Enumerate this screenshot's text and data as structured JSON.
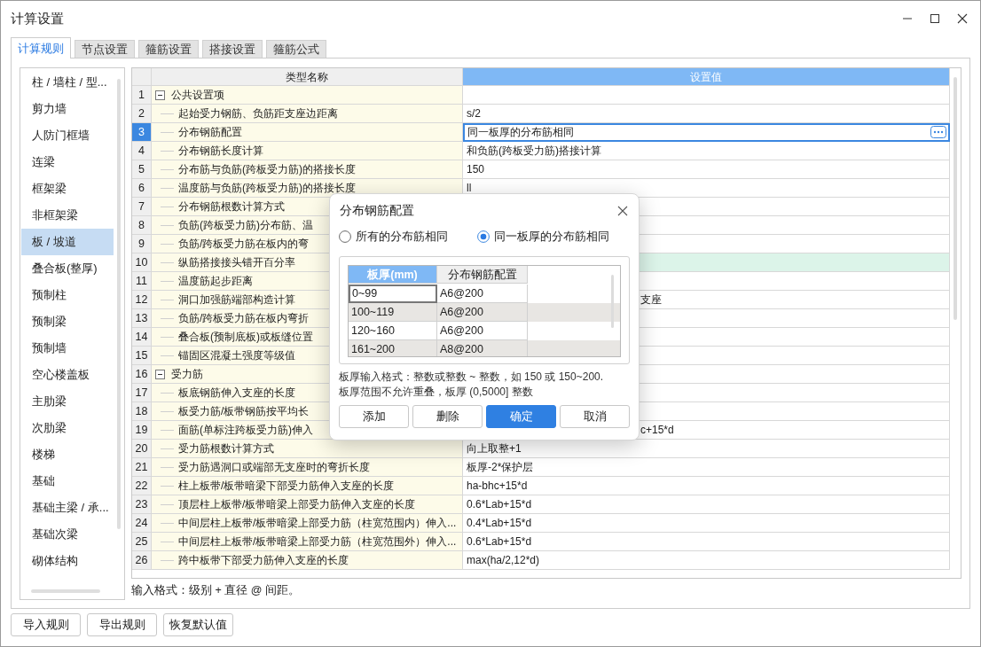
{
  "window": {
    "title": "计算设置"
  },
  "tabs": [
    {
      "label": "计算规则",
      "selected": true
    },
    {
      "label": "节点设置",
      "selected": false
    },
    {
      "label": "箍筋设置",
      "selected": false
    },
    {
      "label": "搭接设置",
      "selected": false
    },
    {
      "label": "箍筋公式",
      "selected": false
    }
  ],
  "sidebar": {
    "items": [
      {
        "label": "柱 / 墙柱 / 型...",
        "selected": false
      },
      {
        "label": "剪力墙",
        "selected": false
      },
      {
        "label": "人防门框墙",
        "selected": false
      },
      {
        "label": "连梁",
        "selected": false
      },
      {
        "label": "框架梁",
        "selected": false
      },
      {
        "label": "非框架梁",
        "selected": false
      },
      {
        "label": "板 / 坡道",
        "selected": true
      },
      {
        "label": "叠合板(整厚)",
        "selected": false
      },
      {
        "label": "预制柱",
        "selected": false
      },
      {
        "label": "预制梁",
        "selected": false
      },
      {
        "label": "预制墙",
        "selected": false
      },
      {
        "label": "空心楼盖板",
        "selected": false
      },
      {
        "label": "主肋梁",
        "selected": false
      },
      {
        "label": "次肋梁",
        "selected": false
      },
      {
        "label": "楼梯",
        "selected": false
      },
      {
        "label": "基础",
        "selected": false
      },
      {
        "label": "基础主梁 / 承...",
        "selected": false
      },
      {
        "label": "基础次梁",
        "selected": false
      },
      {
        "label": "砌体结构",
        "selected": false
      }
    ]
  },
  "table": {
    "columns": [
      {
        "label": "类型名称",
        "selected": false
      },
      {
        "label": "设置值",
        "selected": true
      }
    ],
    "rows": [
      {
        "number": "1",
        "name": "公共设置项",
        "kind": "group",
        "expanded": true,
        "selected": false,
        "children": [
          {
            "number": "2",
            "name": "起始受力钢筋、负筋距支座边距离",
            "value": "s/2",
            "selected": false,
            "highlighted": false
          },
          {
            "number": "3",
            "name": "分布钢筋配置",
            "value": "同一板厚的分布筋相同",
            "selected": true,
            "highlighted": false
          },
          {
            "number": "4",
            "name": "分布钢筋长度计算",
            "value": "和负筋(跨板受力筋)搭接计算",
            "selected": false,
            "highlighted": false
          },
          {
            "number": "5",
            "name": "分布筋与负筋(跨板受力筋)的搭接长度",
            "value": "150",
            "selected": false,
            "highlighted": false
          },
          {
            "number": "6",
            "name": "温度筋与负筋(跨板受力筋)的搭接长度",
            "value": "ll",
            "selected": false,
            "highlighted": false
          },
          {
            "number": "7",
            "name": "分布钢筋根数计算方式",
            "selected": false,
            "highlighted": false
          },
          {
            "number": "8",
            "name": "负筋(跨板受力筋)分布筋、温",
            "selected": false,
            "highlighted": false
          },
          {
            "number": "9",
            "name": "负筋/跨板受力筋在板内的弯",
            "selected": false,
            "highlighted": false
          },
          {
            "number": "10",
            "name": "纵筋搭接接头错开百分率",
            "selected": false,
            "highlighted": true
          },
          {
            "number": "11",
            "name": "温度筋起步距离",
            "selected": false,
            "highlighted": false
          },
          {
            "number": "12",
            "name": "洞口加强筋端部构造计算",
            "value_tail": "支座",
            "selected": false,
            "highlighted": false
          },
          {
            "number": "13",
            "name": "负筋/跨板受力筋在板内弯折",
            "selected": false,
            "highlighted": false
          },
          {
            "number": "14",
            "name": "叠合板(预制底板)或板缝位置",
            "selected": false,
            "highlighted": false
          },
          {
            "number": "15",
            "name": "锚固区混凝土强度等级值",
            "selected": false,
            "highlighted": false
          }
        ]
      },
      {
        "number": "16",
        "name": "受力筋",
        "kind": "group",
        "expanded": true,
        "selected": false,
        "children": [
          {
            "number": "17",
            "name": "板底钢筋伸入支座的长度",
            "selected": false,
            "highlighted": false
          },
          {
            "number": "18",
            "name": "板受力筋/板带钢筋按平均长",
            "selected": false,
            "highlighted": false
          },
          {
            "number": "19",
            "name": "面筋(单标注跨板受力筋)伸入",
            "value_tail": "c+15*d",
            "selected": false,
            "highlighted": false
          },
          {
            "number": "20",
            "name": "受力筋根数计算方式",
            "value": "向上取整+1",
            "selected": false,
            "highlighted": false
          },
          {
            "number": "21",
            "name": "受力筋遇洞口或端部无支座时的弯折长度",
            "value": "板厚-2*保护层",
            "selected": false,
            "highlighted": false
          },
          {
            "number": "22",
            "name": "柱上板带/板带暗梁下部受力筋伸入支座的长度",
            "value": "ha-bhc+15*d",
            "selected": false,
            "highlighted": false
          },
          {
            "number": "23",
            "name": "顶层柱上板带/板带暗梁上部受力筋伸入支座的长度",
            "value": "0.6*Lab+15*d",
            "selected": false,
            "highlighted": false
          },
          {
            "number": "24",
            "name": "中间层柱上板带/板带暗梁上部受力筋（柱宽范围内）伸入...",
            "value": "0.4*Lab+15*d",
            "selected": false,
            "highlighted": false
          },
          {
            "number": "25",
            "name": "中间层柱上板带/板带暗梁上部受力筋（柱宽范围外）伸入...",
            "value": "0.6*Lab+15*d",
            "selected": false,
            "highlighted": false
          },
          {
            "number": "26",
            "name": "跨中板带下部受力筋伸入支座的长度",
            "value": "max(ha/2,12*d)",
            "selected": false,
            "highlighted": false
          }
        ]
      }
    ]
  },
  "hint": "输入格式：级别 + 直径 @ 间距。",
  "buttons": [
    "导入规则",
    "导出规则",
    "恢复默认值"
  ],
  "dialog": {
    "title": "分布钢筋配置",
    "options": [
      {
        "label": "所有的分布筋相同",
        "selected": false
      },
      {
        "label": "同一板厚的分布筋相同",
        "selected": true
      }
    ],
    "grid": {
      "columns": [
        {
          "label": "板厚(mm)",
          "selected": true
        },
        {
          "label": "分布钢筋配置",
          "selected": false
        }
      ],
      "rows": [
        {
          "thickness": "0~99",
          "config": "A6@200",
          "selected": true
        },
        {
          "thickness": "100~119",
          "config": "A6@200",
          "selected": false
        },
        {
          "thickness": "120~160",
          "config": "A6@200",
          "selected": false
        },
        {
          "thickness": "161~200",
          "config": "A8@200",
          "selected": false
        }
      ]
    },
    "note_lines": [
      "板厚输入格式：整数或整数 ~ 整数，如 150 或 150~200.",
      "板厚范围不允许重叠，板厚 (0,5000] 整数"
    ],
    "buttons": [
      {
        "label": "添加",
        "kind": "default"
      },
      {
        "label": "删除",
        "kind": "default"
      },
      {
        "label": "确定",
        "kind": "primary"
      },
      {
        "label": "取消",
        "kind": "default"
      }
    ]
  }
}
